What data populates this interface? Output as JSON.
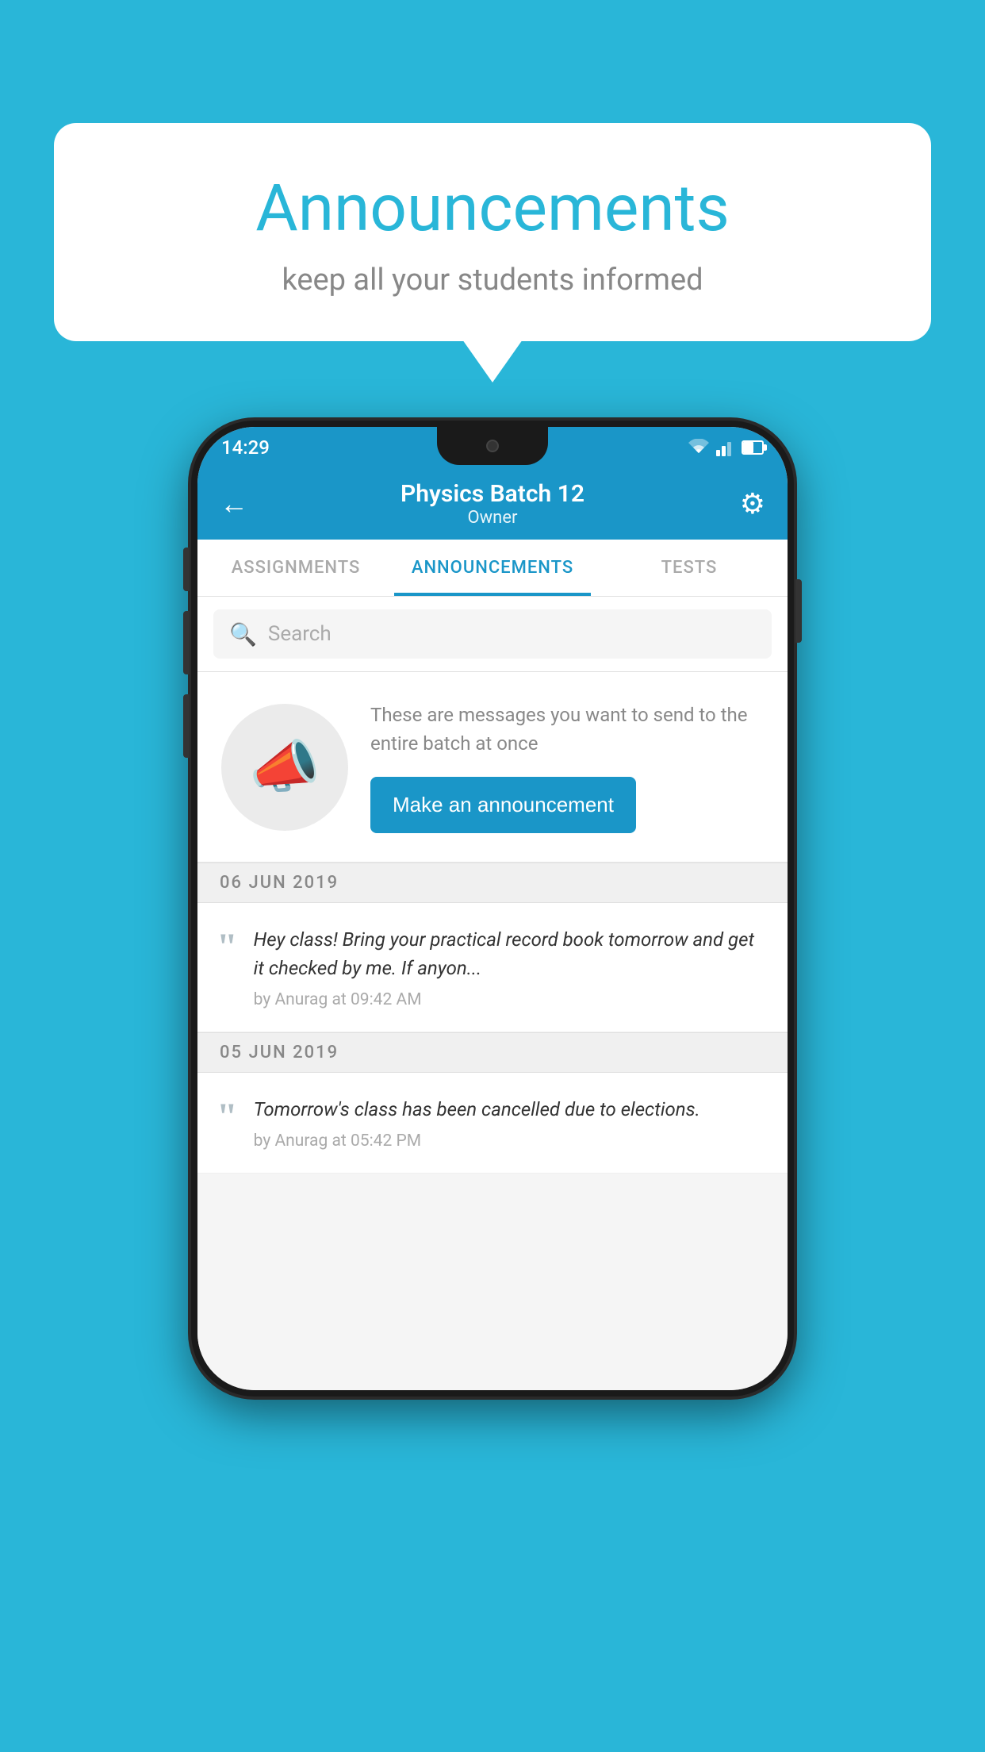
{
  "background_color": "#29b6d8",
  "speech_bubble": {
    "title": "Announcements",
    "subtitle": "keep all your students informed"
  },
  "phone": {
    "status_bar": {
      "time": "14:29"
    },
    "app_bar": {
      "title": "Physics Batch 12",
      "subtitle": "Owner",
      "back_label": "←",
      "settings_label": "⚙"
    },
    "tabs": [
      {
        "label": "ASSIGNMENTS",
        "active": false
      },
      {
        "label": "ANNOUNCEMENTS",
        "active": true
      },
      {
        "label": "TESTS",
        "active": false
      }
    ],
    "search": {
      "placeholder": "Search"
    },
    "promo": {
      "description": "These are messages you want to send to the entire batch at once",
      "button_label": "Make an announcement"
    },
    "announcements": [
      {
        "date": "06  JUN  2019",
        "message": "Hey class! Bring your practical record book tomorrow and get it checked by me. If anyon...",
        "author": "by Anurag at 09:42 AM"
      },
      {
        "date": "05  JUN  2019",
        "message": "Tomorrow's class has been cancelled due to elections.",
        "author": "by Anurag at 05:42 PM"
      }
    ]
  }
}
